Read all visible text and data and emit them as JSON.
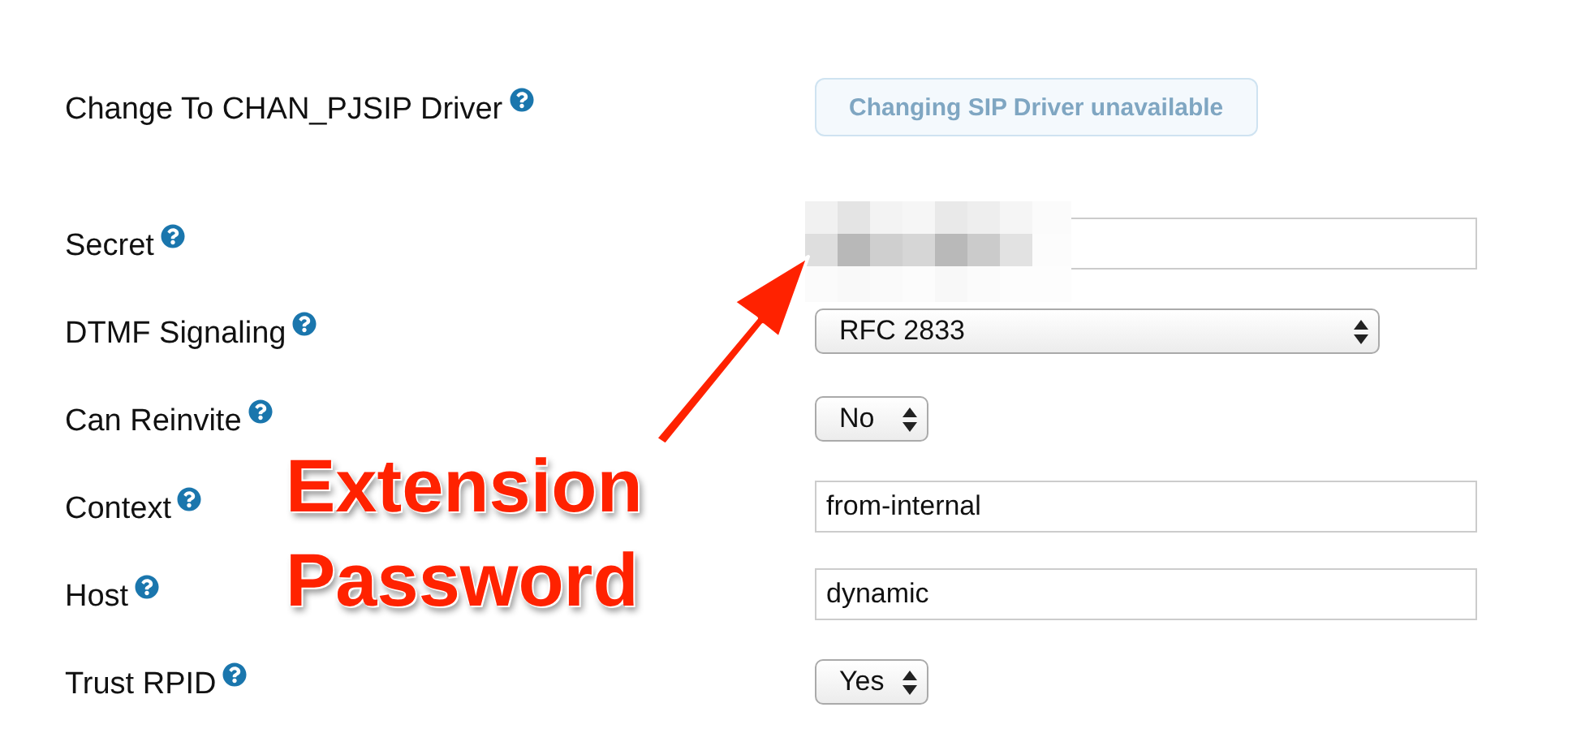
{
  "fields": [
    {
      "label": "Change To CHAN_PJSIP Driver",
      "kind": "button",
      "value": "Changing SIP Driver unavailable",
      "disabled": true
    },
    {
      "label": "Secret",
      "kind": "text",
      "redacted": true
    },
    {
      "label": "DTMF Signaling",
      "kind": "combo",
      "value": "RFC 2833"
    },
    {
      "label": "Can Reinvite",
      "kind": "select",
      "value": "No"
    },
    {
      "label": "Context",
      "kind": "text",
      "value": "from-internal"
    },
    {
      "label": "Host",
      "kind": "text",
      "value": "dynamic"
    },
    {
      "label": "Trust RPID",
      "kind": "select",
      "value": "Yes"
    }
  ],
  "annotation": {
    "text": "Extension Password"
  }
}
